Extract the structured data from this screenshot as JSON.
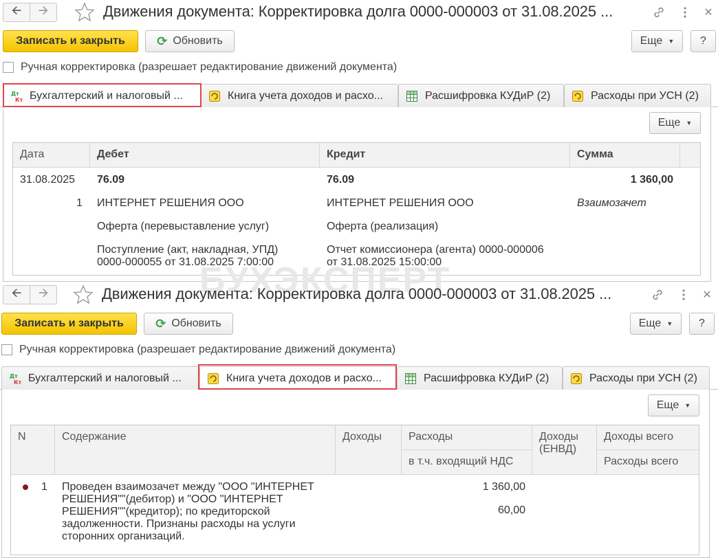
{
  "window_title": "Движения документа: Корректировка долга 0000-000003 от 31.08.2025 ...",
  "toolbar": {
    "save_close": "Записать и закрыть",
    "refresh": "Обновить",
    "more": "Еще",
    "help": "?"
  },
  "manual_edit_label": "Ручная корректировка (разрешает редактирование движений документа)",
  "tabs": [
    {
      "label": "Бухгалтерский и налоговый ..."
    },
    {
      "label": "Книга учета доходов и расхо..."
    },
    {
      "label": "Расшифровка КУДиР (2)"
    },
    {
      "label": "Расходы при УСН (2)"
    }
  ],
  "icon_text": {
    "dt": "Дт",
    "kt": "Кт"
  },
  "panel_more": "Еще",
  "watermark": "БУХЭКСПЕРТ",
  "accounting_table": {
    "columns": {
      "date": "Дата",
      "debit": "Дебет",
      "credit": "Кредит",
      "sum": "Сумма"
    },
    "row": {
      "date": "31.08.2025",
      "number": "1",
      "debit_account": "76.09",
      "credit_account": "76.09",
      "amount": "1 360,00",
      "debit_lines": [
        "ИНТЕРНЕТ РЕШЕНИЯ ООО",
        "Оферта (перевыставление услуг)",
        "Поступление (акт, накладная, УПД)",
        "0000-000055 от 31.08.2025 7:00:00"
      ],
      "credit_lines": [
        "ИНТЕРНЕТ РЕШЕНИЯ ООО",
        "Оферта (реализация)",
        "Отчет комиссионера (агента) 0000-000006",
        "от 31.08.2025 15:00:00"
      ],
      "sum_note": "Взаимозачет"
    }
  },
  "kudir_table": {
    "columns": {
      "n": "N",
      "content": "Содержание",
      "income": "Доходы",
      "expenses": "Расходы",
      "vat_included": "в т.ч. входящий НДС",
      "income_envd_1": "Доходы",
      "income_envd_2": "(ЕНВД)",
      "income_total": "Доходы всего",
      "expenses_total": "Расходы всего"
    },
    "row": {
      "n": "1",
      "content_lines": [
        "Проведен взаимозачет между \"ООО \"ИНТЕРНЕТ",
        "РЕШЕНИЯ\"\"(дебитор) и \"ООО \"ИНТЕРНЕТ",
        "РЕШЕНИЯ\"\"(кредитор); по кредиторской",
        "задолженности. Признаны расходы на услуги",
        "сторонних организаций."
      ],
      "expenses": "1 360,00",
      "vat": "60,00"
    }
  }
}
